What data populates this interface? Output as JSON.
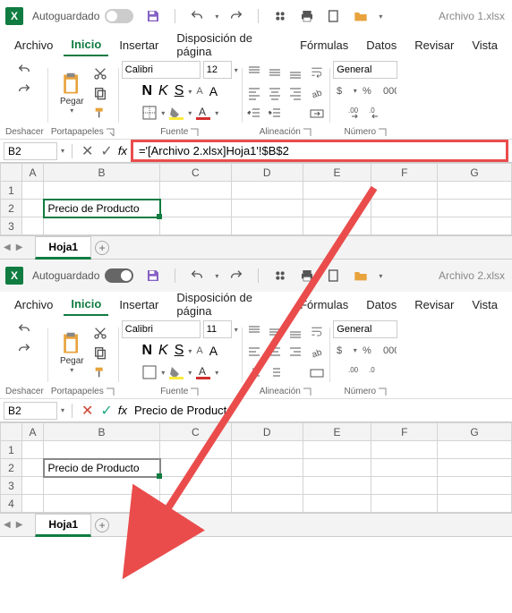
{
  "window1": {
    "autosave": "Autoguardado",
    "filename": "Archivo 1.xlsx",
    "tabs": [
      "Archivo",
      "Inicio",
      "Insertar",
      "Disposición de página",
      "Fórmulas",
      "Datos",
      "Revisar",
      "Vista"
    ],
    "paste": "Pegar",
    "groups": {
      "undo": "Deshacer",
      "clipboard": "Portapapeles",
      "font": "Fuente",
      "alignment": "Alineación",
      "number": "Número"
    },
    "font": {
      "name": "Calibri",
      "size": "12",
      "bold": "N",
      "italic": "K",
      "underline": "S",
      "decrease": "A",
      "increase": "A"
    },
    "numberFormat": "General",
    "cellRef": "B2",
    "fx": "fx",
    "formula": "='[Archivo 2.xlsx]Hoja1'!$B$2",
    "cols": [
      "A",
      "B",
      "C",
      "D",
      "E",
      "F",
      "G"
    ],
    "rows": [
      "1",
      "2",
      "3"
    ],
    "cellB2": "Precio de Producto",
    "sheet": "Hoja1"
  },
  "window2": {
    "autosave": "Autoguardado",
    "filename": "Archivo 2.xlsx",
    "tabs": [
      "Archivo",
      "Inicio",
      "Insertar",
      "Disposición de página",
      "Fórmulas",
      "Datos",
      "Revisar",
      "Vista"
    ],
    "paste": "Pegar",
    "groups": {
      "undo": "Deshacer",
      "clipboard": "Portapapeles",
      "font": "Fuente",
      "alignment": "Alineación",
      "number": "Número"
    },
    "font": {
      "name": "Calibri",
      "size": "11",
      "bold": "N",
      "italic": "K",
      "underline": "S",
      "decrease": "A",
      "increase": "A"
    },
    "numberFormat": "General",
    "cellRef": "B2",
    "fx": "fx",
    "formula": "Precio de Producto",
    "cols": [
      "A",
      "B",
      "C",
      "D",
      "E",
      "F",
      "G"
    ],
    "rows": [
      "1",
      "2",
      "3",
      "4"
    ],
    "cellB2": "Precio de Producto",
    "sheet": "Hoja1"
  }
}
